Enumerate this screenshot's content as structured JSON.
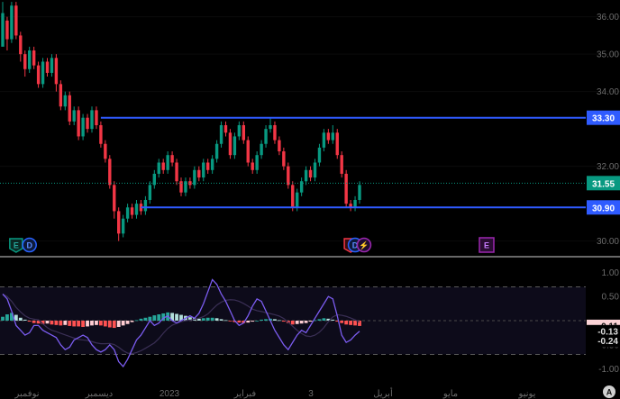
{
  "chart_data": [
    {
      "type": "candlestick",
      "price_axis": {
        "ylim": [
          29.75,
          36.45
        ],
        "ticks": [
          "36.00",
          "35.00",
          "34.00",
          "32.00",
          "30.00"
        ]
      },
      "time_axis": {
        "labels": [
          "نوفمبر",
          "ديسمبر",
          "2023",
          "فبراير",
          "3",
          "أبريل",
          "مايو",
          "يونيو"
        ]
      },
      "horizontal_lines": [
        {
          "value": 33.3,
          "label": "33.30",
          "color": "#2f5bff"
        },
        {
          "value": 30.9,
          "label": "30.90",
          "color": "#2f5bff"
        }
      ],
      "last_price": {
        "value": 31.55,
        "label": "31.55",
        "color": "#089981"
      },
      "up_color": "#089981",
      "down_color": "#f23645",
      "candles": [
        [
          35.2,
          36.1,
          35.9,
          36.4
        ],
        [
          35.9,
          35.4,
          35.1,
          36.0
        ],
        [
          35.4,
          36.3,
          35.3,
          36.4
        ],
        [
          36.3,
          35.5,
          35.4,
          36.4
        ],
        [
          35.5,
          35.0,
          34.8,
          35.6
        ],
        [
          35.0,
          34.6,
          34.4,
          35.1
        ],
        [
          34.6,
          35.1,
          34.5,
          35.2
        ],
        [
          35.1,
          34.7,
          34.6,
          35.2
        ],
        [
          34.7,
          34.2,
          34.1,
          34.8
        ],
        [
          34.2,
          34.8,
          34.1,
          34.9
        ],
        [
          34.8,
          34.5,
          34.4,
          34.9
        ],
        [
          34.5,
          34.9,
          34.4,
          35.0
        ],
        [
          34.9,
          34.2,
          34.0,
          35.0
        ],
        [
          34.2,
          33.6,
          33.5,
          34.3
        ],
        [
          33.6,
          33.9,
          33.5,
          34.0
        ],
        [
          33.9,
          33.2,
          33.1,
          34.0
        ],
        [
          33.2,
          33.5,
          33.1,
          33.6
        ],
        [
          33.5,
          32.8,
          32.7,
          33.6
        ],
        [
          32.8,
          33.3,
          32.7,
          33.4
        ],
        [
          33.3,
          33.0,
          32.9,
          33.4
        ],
        [
          33.0,
          33.5,
          32.9,
          33.6
        ],
        [
          33.5,
          33.1,
          33.0,
          33.6
        ],
        [
          33.1,
          32.6,
          32.5,
          33.2
        ],
        [
          32.6,
          32.2,
          32.1,
          32.7
        ],
        [
          32.2,
          31.5,
          31.4,
          32.3
        ],
        [
          31.5,
          30.8,
          30.6,
          31.6
        ],
        [
          30.8,
          30.2,
          30.0,
          30.9
        ],
        [
          30.2,
          30.6,
          30.1,
          30.7
        ],
        [
          30.6,
          30.9,
          30.5,
          31.0
        ],
        [
          30.9,
          30.7,
          30.6,
          31.0
        ],
        [
          30.7,
          31.0,
          30.6,
          31.1
        ],
        [
          31.0,
          30.8,
          30.7,
          31.1
        ],
        [
          30.8,
          31.1,
          30.7,
          31.2
        ],
        [
          31.1,
          31.5,
          31.0,
          31.6
        ],
        [
          31.5,
          31.8,
          31.4,
          31.9
        ],
        [
          31.8,
          32.1,
          31.7,
          32.2
        ],
        [
          32.1,
          31.9,
          31.8,
          32.2
        ],
        [
          31.9,
          32.3,
          31.8,
          32.4
        ],
        [
          32.3,
          32.1,
          32.0,
          32.4
        ],
        [
          32.1,
          31.6,
          31.5,
          32.2
        ],
        [
          31.6,
          31.3,
          31.2,
          31.7
        ],
        [
          31.3,
          31.6,
          31.2,
          31.7
        ],
        [
          31.6,
          31.5,
          31.4,
          31.7
        ],
        [
          31.5,
          31.9,
          31.4,
          32.0
        ],
        [
          31.9,
          31.7,
          31.6,
          32.0
        ],
        [
          31.7,
          32.1,
          31.6,
          32.2
        ],
        [
          32.1,
          31.9,
          31.8,
          32.2
        ],
        [
          31.9,
          32.2,
          31.8,
          32.3
        ],
        [
          32.2,
          32.6,
          32.1,
          32.7
        ],
        [
          32.6,
          33.1,
          32.5,
          33.2
        ],
        [
          33.1,
          32.9,
          32.8,
          33.2
        ],
        [
          32.9,
          32.3,
          32.2,
          33.0
        ],
        [
          32.3,
          32.8,
          32.2,
          32.9
        ],
        [
          32.8,
          33.1,
          32.7,
          33.2
        ],
        [
          33.1,
          32.7,
          32.6,
          33.2
        ],
        [
          32.7,
          32.1,
          32.0,
          32.8
        ],
        [
          32.1,
          31.9,
          31.8,
          32.2
        ],
        [
          31.9,
          32.3,
          31.8,
          32.4
        ],
        [
          32.3,
          32.6,
          32.2,
          32.7
        ],
        [
          32.6,
          33.0,
          32.5,
          33.1
        ],
        [
          33.0,
          33.1,
          32.9,
          33.3
        ],
        [
          33.1,
          32.7,
          32.6,
          33.2
        ],
        [
          32.7,
          32.4,
          32.3,
          32.8
        ],
        [
          32.4,
          32.0,
          31.9,
          32.5
        ],
        [
          32.0,
          31.5,
          31.4,
          32.1
        ],
        [
          31.5,
          30.9,
          30.8,
          31.6
        ],
        [
          30.9,
          31.3,
          30.8,
          31.4
        ],
        [
          31.3,
          31.6,
          31.2,
          31.7
        ],
        [
          31.6,
          31.9,
          31.5,
          32.0
        ],
        [
          31.9,
          31.7,
          31.6,
          32.0
        ],
        [
          31.7,
          32.1,
          31.6,
          32.2
        ],
        [
          32.1,
          32.5,
          32.0,
          32.6
        ],
        [
          32.5,
          32.9,
          32.4,
          33.0
        ],
        [
          32.9,
          32.7,
          32.6,
          33.0
        ],
        [
          32.7,
          32.9,
          32.6,
          33.1
        ],
        [
          32.9,
          32.3,
          32.2,
          33.0
        ],
        [
          32.3,
          31.8,
          31.7,
          32.4
        ],
        [
          31.8,
          31.0,
          30.9,
          31.9
        ],
        [
          31.0,
          30.9,
          30.8,
          31.1
        ],
        [
          30.9,
          31.1,
          30.8,
          31.2
        ],
        [
          31.1,
          31.5,
          31.0,
          31.6
        ]
      ],
      "event_markers": [
        {
          "label": "E",
          "bg": "#0b2a24",
          "border": "#089981",
          "fg": "#26a69a",
          "shape": "pentagon",
          "candle": 3
        },
        {
          "label": "D",
          "bg": "#0d1a3a",
          "border": "#2962ff",
          "fg": "#5b8cff",
          "shape": "circle",
          "candle": 6
        },
        {
          "label": "E",
          "bg": "#3a0d10",
          "border": "#f23645",
          "fg": "#f23645",
          "shape": "pentagon",
          "candle": 78
        },
        {
          "label": "D",
          "bg": "#0d1a3a",
          "border": "#2962ff",
          "fg": "#5b8cff",
          "shape": "circle",
          "candle": 79
        },
        {
          "label": "⚡",
          "bg": "#1e0d30",
          "border": "#9c27b0",
          "fg": "#c77dff",
          "shape": "circle",
          "candle": 81
        },
        {
          "label": "E",
          "bg": "#2a0d33",
          "border": "#9c27b0",
          "fg": "#c77dff",
          "shape": "square",
          "candle": 111
        }
      ]
    },
    {
      "type": "oscillator",
      "ylim": [
        -1.1,
        1.1
      ],
      "ticks": [
        "1.00",
        "0.50",
        "-0.50",
        "-1.00"
      ],
      "bands": [
        0.7,
        -0.7
      ],
      "value_labels": [
        {
          "label": "-0.11",
          "value": -0.11,
          "bg": "#fbd3d6",
          "fg": "#111111"
        },
        {
          "label": "-0.13",
          "value": -0.22,
          "bg": "#000000",
          "fg": "#dddddd"
        },
        {
          "label": "-0.24",
          "value": -0.42,
          "bg": "#000000",
          "fg": "#dddddd"
        }
      ],
      "histogram": [
        0.08,
        0.13,
        0.16,
        0.12,
        0.06,
        0.02,
        -0.02,
        -0.05,
        -0.06,
        -0.07,
        -0.06,
        -0.08,
        -0.09,
        -0.1,
        -0.09,
        -0.11,
        -0.12,
        -0.12,
        -0.13,
        -0.12,
        -0.1,
        -0.09,
        -0.1,
        -0.12,
        -0.14,
        -0.15,
        -0.13,
        -0.1,
        -0.07,
        -0.03,
        0.01,
        0.04,
        0.06,
        0.08,
        0.11,
        0.13,
        0.15,
        0.17,
        0.16,
        0.14,
        0.12,
        0.1,
        0.07,
        0.05,
        0.04,
        0.05,
        0.06,
        0.06,
        0.05,
        0.03,
        0.01,
        -0.01,
        -0.03,
        -0.04,
        -0.05,
        -0.04,
        -0.02,
        0.0,
        0.02,
        0.03,
        0.04,
        0.03,
        0.01,
        -0.02,
        -0.05,
        -0.08,
        -0.07,
        -0.06,
        -0.05,
        -0.02,
        0.01,
        0.03,
        0.05,
        0.04,
        0.02,
        -0.02,
        -0.05,
        -0.08,
        -0.09,
        -0.1,
        -0.11
      ],
      "line": [
        0.55,
        0.45,
        0.2,
        -0.1,
        -0.2,
        -0.3,
        -0.25,
        -0.1,
        -0.1,
        -0.2,
        -0.25,
        -0.3,
        -0.35,
        -0.5,
        -0.6,
        -0.55,
        -0.4,
        -0.35,
        -0.3,
        -0.35,
        -0.5,
        -0.6,
        -0.65,
        -0.6,
        -0.5,
        -0.6,
        -0.85,
        -0.95,
        -0.8,
        -0.6,
        -0.4,
        -0.3,
        -0.15,
        0.0,
        -0.1,
        -0.05,
        0.05,
        0.1,
        0.0,
        -0.05,
        0.0,
        0.05,
        0.1,
        0.05,
        0.15,
        0.35,
        0.6,
        0.85,
        0.75,
        0.55,
        0.4,
        0.2,
        0.0,
        -0.1,
        -0.05,
        0.1,
        0.3,
        0.45,
        0.4,
        0.2,
        0.0,
        -0.2,
        -0.35,
        -0.5,
        -0.6,
        -0.45,
        -0.3,
        -0.2,
        -0.25,
        -0.1,
        0.05,
        0.2,
        0.35,
        0.5,
        0.45,
        0.1,
        -0.3,
        -0.45,
        -0.4,
        -0.3,
        -0.22
      ],
      "line_color": "#7b5cf0",
      "slow_line_color": "#3a2f55"
    }
  ],
  "footer": {
    "badge": "A"
  }
}
